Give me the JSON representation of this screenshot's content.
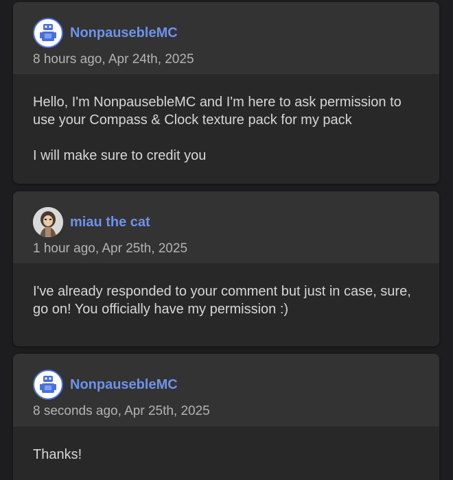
{
  "comments": [
    {
      "author": "NonpausebleMC",
      "avatar_icon": "robot-avatar-icon",
      "timestamp": "8 hours ago, Apr 24th, 2025",
      "paragraphs": [
        "Hello, I'm NonpausebleMC and I'm here to ask permission to use your Compass & Clock texture pack for my pack",
        "I will make sure to credit you"
      ]
    },
    {
      "author": "miau the cat",
      "avatar_icon": "cat-avatar-icon",
      "timestamp": "1 hour ago, Apr 25th, 2025",
      "paragraphs": [
        "I've already responded to your comment but just in case, sure, go on! You officially have my permission :)"
      ]
    },
    {
      "author": "NonpausebleMC",
      "avatar_icon": "robot-avatar-icon",
      "timestamp": "8 seconds ago, Apr 25th, 2025",
      "paragraphs": [
        "Thanks!"
      ]
    }
  ],
  "colors": {
    "page_background": "#1d1d1f",
    "card_body": "#282829",
    "card_header": "#333334",
    "username": "#6d93ea",
    "timestamp": "#b4b4b4",
    "body_text": "#d7d7d7"
  }
}
